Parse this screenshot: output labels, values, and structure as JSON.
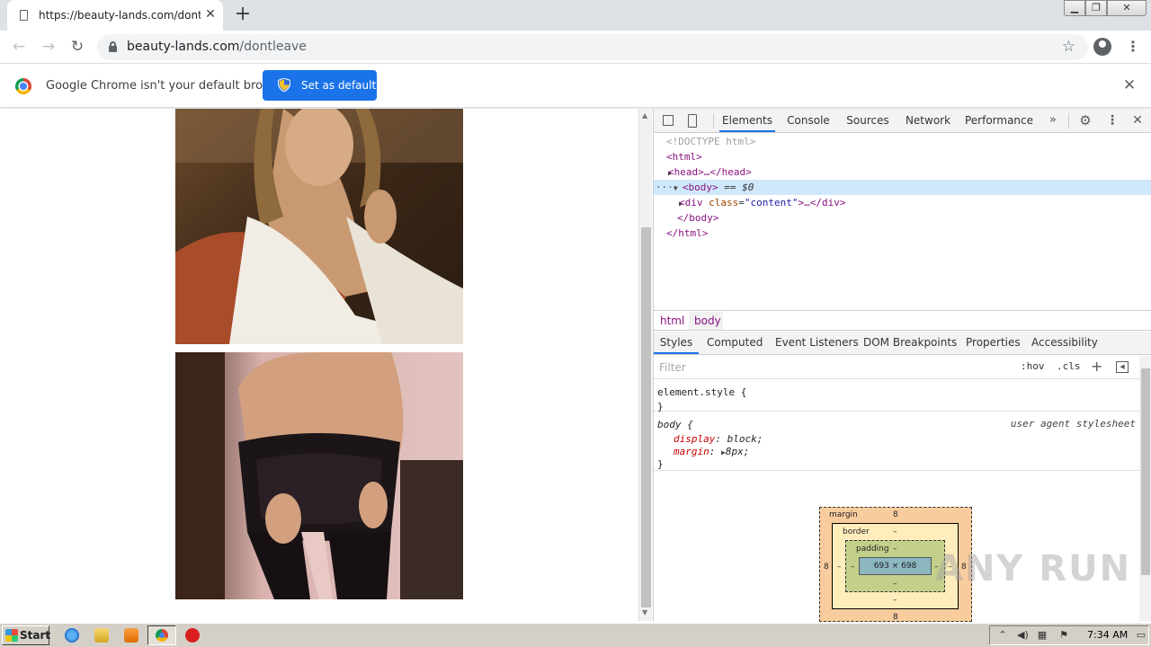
{
  "browser": {
    "tab_title": "https://beauty-lands.com/dontleave",
    "url_domain": "beauty-lands.com",
    "url_path": "/dontleave"
  },
  "infobar": {
    "message": "Google Chrome isn't your default browser",
    "button": "Set as default"
  },
  "devtools": {
    "tabs": [
      "Elements",
      "Console",
      "Sources",
      "Network",
      "Performance"
    ],
    "dom": {
      "doctype": "<!DOCTYPE html>",
      "html_open": "<html>",
      "head": "<head>…</head>",
      "body_open": "<body>",
      "body_marker": "== $0",
      "div_open": "<div",
      "div_attr_name": "class",
      "div_attr_value": "\"content\"",
      "div_close": ">…</div>",
      "body_close": "</body>",
      "html_close": "</html>"
    },
    "breadcrumbs": [
      "html",
      "body"
    ],
    "style_tabs": [
      "Styles",
      "Computed",
      "Event Listeners",
      "DOM Breakpoints",
      "Properties",
      "Accessibility"
    ],
    "filter_placeholder": "Filter",
    "hov": ":hov",
    "cls": ".cls",
    "rules": {
      "element_style": "element.style {",
      "close_brace": "}",
      "body_selector": "body {",
      "origin": "user agent stylesheet",
      "decl1_name": "display",
      "decl1_value": "block;",
      "decl2_name": "margin",
      "decl2_value": "8px;"
    },
    "box_model": {
      "margin_label": "margin",
      "margin_top": "8",
      "margin_bottom": "8",
      "margin_left": "8",
      "margin_right": "8",
      "border_label": "border",
      "border_value": "–",
      "padding_label": "padding",
      "padding_value": "–",
      "content": "693 × 698"
    }
  },
  "watermark": "ANY RUN",
  "taskbar": {
    "start": "Start",
    "clock": "7:34 AM"
  }
}
